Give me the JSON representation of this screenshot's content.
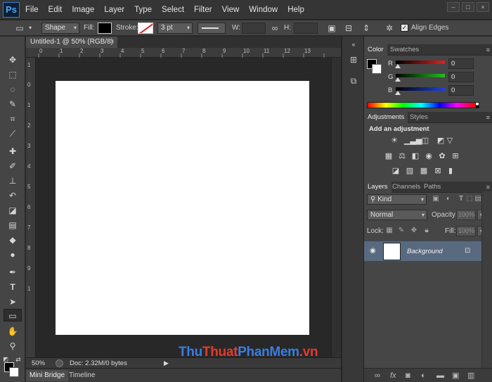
{
  "app": {
    "logo": "Ps"
  },
  "menu": [
    "File",
    "Edit",
    "Image",
    "Layer",
    "Type",
    "Select",
    "Filter",
    "View",
    "Window",
    "Help"
  ],
  "window_controls": [
    "–",
    "□",
    "×"
  ],
  "options_bar": {
    "shape_mode": "Shape",
    "fill_label": "Fill:",
    "stroke_label": "Stroke:",
    "stroke_width": "3 pt",
    "w_label": "W:",
    "h_label": "H:",
    "align_edges_label": "Align Edges",
    "align_edges_checked": true
  },
  "document": {
    "tab_title": "Untitled-1 @ 50% (RGB/8)",
    "tab_close": "×",
    "ruler_h": [
      "0",
      "1",
      "2",
      "3",
      "4",
      "5",
      "6",
      "7",
      "8",
      "9",
      "10",
      "11",
      "12",
      "13"
    ],
    "ruler_v": [
      "1",
      "0",
      "1",
      "2",
      "3",
      "4",
      "5",
      "6",
      "7",
      "8",
      "9",
      "1"
    ],
    "zoom": "50%",
    "doc_info": "Doc: 2.32M/0 bytes"
  },
  "bottom_tabs": [
    "Mini Bridge",
    "Timeline"
  ],
  "watermark": {
    "part1": "Thu",
    "part2": "Thuat",
    "part3": "PhanMem",
    "part4": ".vn"
  },
  "color_panel": {
    "tabs": [
      "Color",
      "Swatches"
    ],
    "channels": [
      {
        "label": "R",
        "value": "0",
        "color": "#e02020"
      },
      {
        "label": "G",
        "value": "0",
        "color": "#20c020"
      },
      {
        "label": "B",
        "value": "0",
        "color": "#2040e0"
      }
    ]
  },
  "adjustments_panel": {
    "tabs": [
      "Adjustments",
      "Styles"
    ],
    "title": "Add an adjustment"
  },
  "layers_panel": {
    "tabs": [
      "Layers",
      "Channels",
      "Paths"
    ],
    "kind_filter": "Kind",
    "blend_mode": "Normal",
    "opacity_label": "Opacity:",
    "opacity_value": "100%",
    "lock_label": "Lock:",
    "fill_label": "Fill:",
    "fill_value": "100%",
    "layers": [
      {
        "name": "Background",
        "visible": true,
        "locked": true
      }
    ]
  }
}
